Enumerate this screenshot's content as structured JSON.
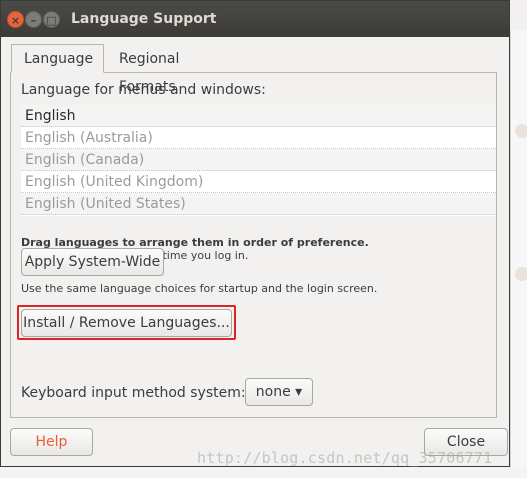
{
  "window": {
    "title": "Language Support",
    "close_glyph": "×",
    "minimize_glyph": "–",
    "maximize_glyph": "□"
  },
  "tabs": [
    {
      "label": "Language",
      "active": true
    },
    {
      "label": "Regional Formats",
      "active": false
    }
  ],
  "language_section": {
    "label": "Language for menus and windows:",
    "languages": [
      "English",
      "English (Australia)",
      "English (Canada)",
      "English (United Kingdom)",
      "English (United States)"
    ]
  },
  "hints": {
    "drag_bold": "Drag languages to arrange them in order of preference.",
    "drag_note": "Changes take effect next time you log in.",
    "apply_note": "Use the same language choices for startup and the login screen."
  },
  "buttons": {
    "apply_system_wide": "Apply System-Wide",
    "install_remove": "Install / Remove Languages...",
    "help": "Help",
    "close": "Close"
  },
  "keyboard": {
    "label": "Keyboard input method system:",
    "selected": "none",
    "arrow_glyph": "▾"
  },
  "watermark": "http://blog.csdn.net/qq_35706771",
  "colors": {
    "titlebar": "#3c3b37",
    "close_button": "#e8643a",
    "help_text": "#e4603a",
    "highlight_border": "#e02424"
  }
}
